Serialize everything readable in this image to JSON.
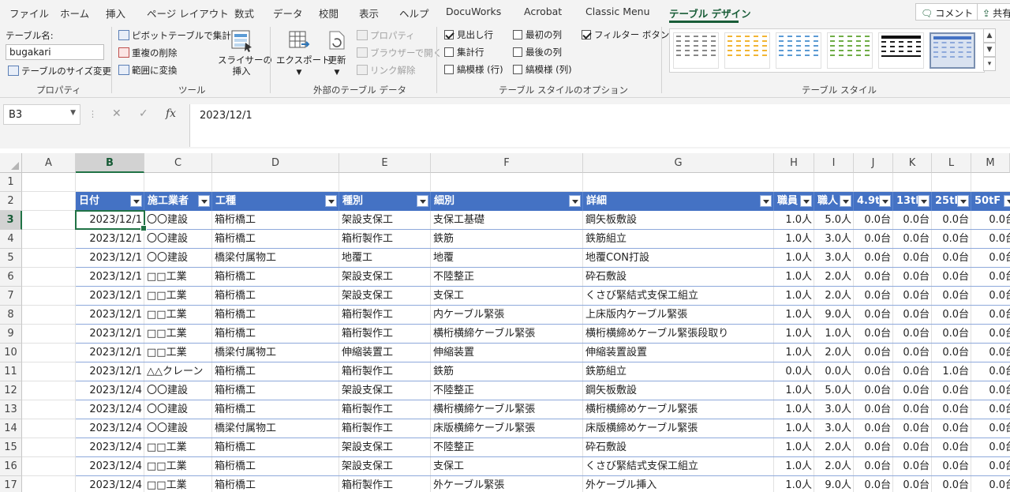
{
  "ribbon_tabs": [
    "ファイル",
    "ホーム",
    "挿入",
    "ページ レイアウト",
    "数式",
    "データ",
    "校閲",
    "表示",
    "ヘルプ",
    "DocuWorks",
    "Acrobat",
    "Classic Menu",
    "テーブル デザイン"
  ],
  "active_tab": "テーブル デザイン",
  "top_buttons": {
    "comment": "コメント",
    "share": "共有"
  },
  "properties": {
    "table_name_label": "テーブル名:",
    "table_name_value": "bugakari",
    "resize": "テーブルのサイズ変更",
    "group_label": "プロパティ"
  },
  "tools": {
    "pivot": "ピボットテーブルで集計",
    "remove_dup": "重複の削除",
    "convert_range": "範囲に変換",
    "slicer_line1": "スライサーの",
    "slicer_line2": "挿入",
    "group_label": "ツール"
  },
  "external": {
    "export": "エクスポート",
    "refresh": "更新",
    "properties": "プロパティ",
    "open_browser": "ブラウザーで開く",
    "unlink": "リンク解除",
    "group_label": "外部のテーブル データ"
  },
  "style_options": {
    "header_row": "見出し行",
    "first_column": "最初の列",
    "filter_button": "フィルター ボタン",
    "total_row": "集計行",
    "last_column": "最後の列",
    "banded_rows": "縞模様 (行)",
    "banded_columns": "縞模様 (列)",
    "group_label": "テーブル スタイルのオプション"
  },
  "table_styles": {
    "group_label": "テーブル スタイル"
  },
  "colors": {
    "accent": "#185c37",
    "table_header": "#4472c4",
    "band_line": "#8ea9db"
  },
  "formula_bar": {
    "name_box": "B3",
    "formula": "2023/12/1"
  },
  "grid": {
    "col_letters": [
      "A",
      "B",
      "C",
      "D",
      "E",
      "F",
      "G",
      "H",
      "I",
      "J",
      "K",
      "L",
      "M"
    ],
    "row_numbers": [
      "1",
      "2",
      "3",
      "4",
      "5",
      "6",
      "7",
      "8",
      "9",
      "10",
      "11",
      "12",
      "13",
      "14",
      "15",
      "16",
      "17"
    ],
    "headers": [
      "日付",
      "施工業者",
      "工種",
      "種別",
      "細別",
      "詳細",
      "職員",
      "職人",
      "4.9t",
      "13tF",
      "25tF",
      "50tF"
    ],
    "rows": [
      [
        "2023/12/1",
        "〇〇建設",
        "箱桁橋工",
        "架設支保工",
        "支保工基礎",
        "鋼矢板敷設",
        "1.0人",
        "5.0人",
        "0.0台",
        "0.0台",
        "0.0台",
        "0.0台"
      ],
      [
        "2023/12/1",
        "〇〇建設",
        "箱桁橋工",
        "箱桁製作工",
        "鉄筋",
        "鉄筋組立",
        "1.0人",
        "3.0人",
        "0.0台",
        "0.0台",
        "0.0台",
        "0.0台"
      ],
      [
        "2023/12/1",
        "〇〇建設",
        "橋梁付属物工",
        "地覆工",
        "地覆",
        "地覆CON打設",
        "1.0人",
        "3.0人",
        "0.0台",
        "0.0台",
        "0.0台",
        "0.0台"
      ],
      [
        "2023/12/1",
        "□□工業",
        "箱桁橋工",
        "架設支保工",
        "不陸整正",
        "砕石敷設",
        "1.0人",
        "2.0人",
        "0.0台",
        "0.0台",
        "0.0台",
        "0.0台"
      ],
      [
        "2023/12/1",
        "□□工業",
        "箱桁橋工",
        "架設支保工",
        "支保工",
        "くさび緊結式支保工組立",
        "1.0人",
        "2.0人",
        "0.0台",
        "0.0台",
        "0.0台",
        "0.0台"
      ],
      [
        "2023/12/1",
        "□□工業",
        "箱桁橋工",
        "箱桁製作工",
        "内ケーブル緊張",
        "上床版内ケーブル緊張",
        "1.0人",
        "9.0人",
        "0.0台",
        "0.0台",
        "0.0台",
        "0.0台"
      ],
      [
        "2023/12/1",
        "□□工業",
        "箱桁橋工",
        "箱桁製作工",
        "横桁横締ケーブル緊張",
        "横桁横締めケーブル緊張段取り",
        "1.0人",
        "1.0人",
        "0.0台",
        "0.0台",
        "0.0台",
        "0.0台"
      ],
      [
        "2023/12/1",
        "□□工業",
        "橋梁付属物工",
        "伸縮装置工",
        "伸縮装置",
        "伸縮装置設置",
        "1.0人",
        "2.0人",
        "0.0台",
        "0.0台",
        "0.0台",
        "0.0台"
      ],
      [
        "2023/12/1",
        "△△クレーン",
        "箱桁橋工",
        "箱桁製作工",
        "鉄筋",
        "鉄筋組立",
        "0.0人",
        "0.0人",
        "0.0台",
        "0.0台",
        "1.0台",
        "0.0台"
      ],
      [
        "2023/12/4",
        "〇〇建設",
        "箱桁橋工",
        "架設支保工",
        "不陸整正",
        "鋼矢板敷設",
        "1.0人",
        "5.0人",
        "0.0台",
        "0.0台",
        "0.0台",
        "0.0台"
      ],
      [
        "2023/12/4",
        "〇〇建設",
        "箱桁橋工",
        "箱桁製作工",
        "横桁横締ケーブル緊張",
        "横桁横締めケーブル緊張",
        "1.0人",
        "3.0人",
        "0.0台",
        "0.0台",
        "0.0台",
        "0.0台"
      ],
      [
        "2023/12/4",
        "〇〇建設",
        "橋梁付属物工",
        "箱桁製作工",
        "床版横締ケーブル緊張",
        "床版横締めケーブル緊張",
        "1.0人",
        "3.0人",
        "0.0台",
        "0.0台",
        "0.0台",
        "0.0台"
      ],
      [
        "2023/12/4",
        "□□工業",
        "箱桁橋工",
        "架設支保工",
        "不陸整正",
        "砕石敷設",
        "1.0人",
        "2.0人",
        "0.0台",
        "0.0台",
        "0.0台",
        "0.0台"
      ],
      [
        "2023/12/4",
        "□□工業",
        "箱桁橋工",
        "架設支保工",
        "支保工",
        "くさび緊結式支保工組立",
        "1.0人",
        "2.0人",
        "0.0台",
        "0.0台",
        "0.0台",
        "0.0台"
      ],
      [
        "2023/12/4",
        "□□工業",
        "箱桁橋工",
        "箱桁製作工",
        "外ケーブル緊張",
        "外ケーブル挿入",
        "1.0人",
        "9.0人",
        "0.0台",
        "0.0台",
        "0.0台",
        "0.0台"
      ]
    ]
  }
}
